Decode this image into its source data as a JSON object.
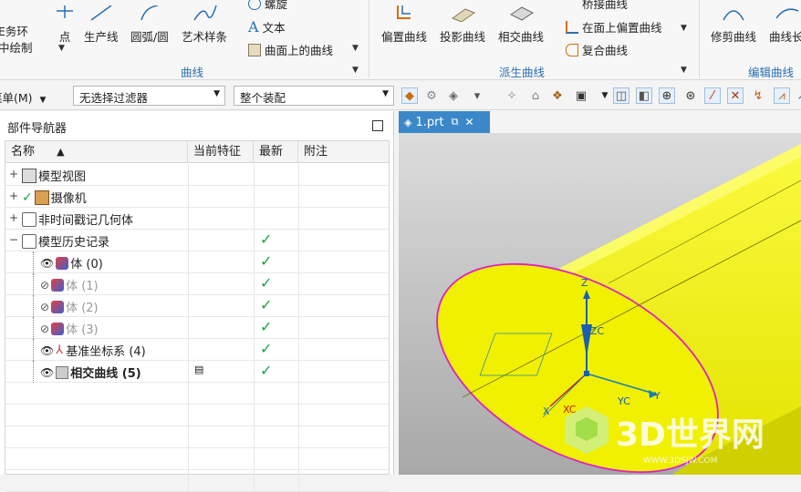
{
  "ribbon": {
    "curve_group": {
      "label": "曲线",
      "buttons": [
        {
          "label": "任务环\n境中绘制",
          "line1": "E务环",
          "line2": "中绘制"
        },
        {
          "label": "点"
        },
        {
          "label": "生产线"
        },
        {
          "label": "圆弧/圆"
        },
        {
          "label": "艺术样条"
        }
      ],
      "small_items": [
        "螺旋",
        "文本",
        "曲面上的曲线"
      ]
    },
    "derived_group": {
      "label": "派生曲线",
      "buttons": [
        {
          "label": "偏置曲线"
        },
        {
          "label": "投影曲线"
        },
        {
          "label": "相交曲线"
        }
      ],
      "small_items": [
        "桥接曲线",
        "在面上偏置曲线",
        "复合曲线"
      ]
    },
    "edit_group": {
      "label": "编辑曲线",
      "buttons": [
        {
          "label": "修剪曲线"
        },
        {
          "label": "曲线长"
        }
      ]
    }
  },
  "toolbar": {
    "menu_label": "菜单(M)",
    "filter_value": "无选择过滤器",
    "assembly_value": "整个装配"
  },
  "navigator": {
    "title": "部件导航器",
    "columns": [
      "名称",
      "当前特征",
      "最新",
      "附注"
    ],
    "rows": [
      {
        "name": "模型视图",
        "expander": "+",
        "latest": false,
        "style": "normal",
        "indent": 0
      },
      {
        "name": "摄像机",
        "expander": "+",
        "latest": false,
        "style": "normal",
        "indent": 0
      },
      {
        "name": "非时间戳记几何体",
        "expander": "+",
        "latest": false,
        "style": "normal",
        "indent": 0
      },
      {
        "name": "模型历史记录",
        "expander": "−",
        "latest": true,
        "style": "normal",
        "indent": 0
      },
      {
        "name": "体 (0)",
        "latest": true,
        "style": "normal",
        "indent": 1
      },
      {
        "name": "体 (1)",
        "latest": true,
        "style": "gray",
        "indent": 1
      },
      {
        "name": "体 (2)",
        "latest": true,
        "style": "gray",
        "indent": 1
      },
      {
        "name": "体 (3)",
        "latest": true,
        "style": "gray",
        "indent": 1
      },
      {
        "name": "基准坐标系 (4)",
        "latest": true,
        "style": "normal",
        "indent": 1
      },
      {
        "name": "相交曲线 (5)",
        "latest": true,
        "style": "bold",
        "indent": 1
      }
    ]
  },
  "viewport": {
    "tab_label": "1.prt",
    "axes": {
      "z": "Z",
      "zc": "ZC",
      "y": "Y",
      "yc": "YC",
      "x": "X",
      "xc": "XC"
    },
    "watermark": {
      "main": "3D世界网",
      "sub": "WWW.3DSJW.COM"
    },
    "colors": {
      "cylinder": "#f7f700",
      "curve": "#e020c0",
      "background": "#c8c8c8"
    }
  }
}
